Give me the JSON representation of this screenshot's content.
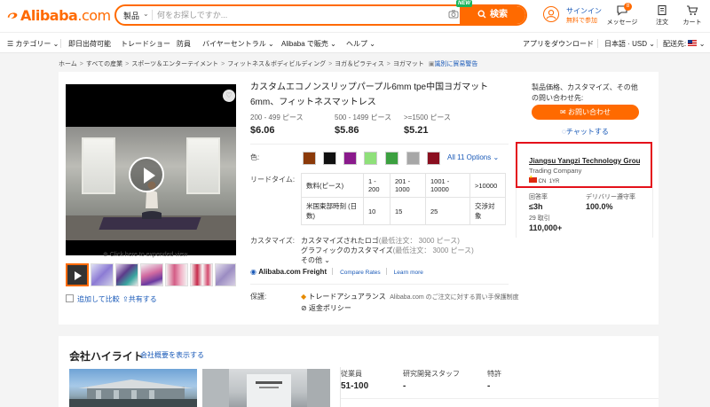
{
  "header": {
    "logo_text": "Alibaba",
    "logo_suffix": ".com",
    "search_category": "製品",
    "search_placeholder": "何をお探しですか...",
    "search_button": "検索",
    "new_badge": "NEW",
    "signin_line1": "サインイン",
    "signin_line2": "無料で参加",
    "messages_label": "メッセージ",
    "messages_count": "8",
    "orders_label": "注文",
    "cart_label": "カート"
  },
  "nav": {
    "categories": "カテゴリー",
    "items": [
      "即日出荷可能",
      "トレードショー",
      "防員",
      "バイヤーセントラル",
      "Alibaba で販売",
      "ヘルプ"
    ],
    "download_app": "アプリをダウンロード",
    "language_currency": "日本語 · USD",
    "ship_to": "配送先:"
  },
  "breadcrumb": {
    "items": [
      "ホーム",
      "すべての産業",
      "スポーツ＆エンターテイメント",
      "フィットネス＆ボディビルディング",
      "ヨガ＆ピラティス",
      "ヨガマット"
    ],
    "report": "識別に貿易警告"
  },
  "gallery": {
    "expand_text": "Click here to expended view",
    "compare_text": "追加して比較",
    "share_text": "共有する"
  },
  "product": {
    "title": "カスタムエコノンスリップパープル6mm tpe中国ヨガマット6mm、フィットネスマットレス",
    "tiers": [
      {
        "qty": "200 - 499 ピース",
        "price": "$6.06"
      },
      {
        "qty": "500 - 1499 ピース",
        "price": "$5.86"
      },
      {
        "qty": ">=1500 ピース",
        "price": "$5.21"
      }
    ],
    "color_label": "色:",
    "color_swatches": [
      "#8b3a0a",
      "#111111",
      "#8a1a8c",
      "#8fe07a",
      "#3ca040",
      "#a7a7a7",
      "#8a0f1f"
    ],
    "options_link": "All 11 Options",
    "lead_label": "リードタイム:",
    "lead_table": {
      "row1": [
        "数料(ピース)",
        "1 - 200",
        "201 - 1000",
        "1001 - 10000",
        ">10000"
      ],
      "row2": [
        "米国東部時刻 (日数)",
        "10",
        "15",
        "25",
        "交渉対象"
      ]
    },
    "customize_label": "カスタマイズ:",
    "customize_lines": [
      {
        "name": "カスタマイズされたロゴ",
        "note": "(最低注文： 3000 ピース)"
      },
      {
        "name": "グラフィックのカスタマイズ",
        "note": "(最低注文： 3000 ピース)"
      }
    ],
    "customize_more": "その他",
    "freight_name": "Alibaba.com Freight",
    "freight_compare": "Compare Rates",
    "freight_learn": "Learn more",
    "protection_label": "保護:",
    "trade_assurance": "トレードアシュアランス",
    "trade_assurance_note": "Alibaba.com のご注文に対する買い手保護制度",
    "refund_policy": "返金ポリシー"
  },
  "sidebar": {
    "heading": "製品価格、カスタマイズ、その他の問い合わせ先:",
    "inquire_button": "お問い合わせ",
    "chat_link": "チャットする",
    "supplier_name": "Jiangsu Yangzi Technology Group...",
    "supplier_type": "Trading Company",
    "supplier_country": "CN",
    "supplier_years": "1YR",
    "stats": [
      {
        "label": "回答率",
        "value": "≤3h"
      },
      {
        "label": "デリバリー遵守率",
        "value": "100.0%"
      },
      {
        "label": "29 取引",
        "value": "110,000+"
      }
    ]
  },
  "highlight": {
    "title": "会社ハイライト",
    "overview_link": "会社概要を表示する",
    "stats": [
      {
        "label": "従業員",
        "value": "51-100"
      },
      {
        "label": "研究開発スタッフ",
        "value": "-"
      },
      {
        "label": "特許",
        "value": "-"
      }
    ]
  }
}
